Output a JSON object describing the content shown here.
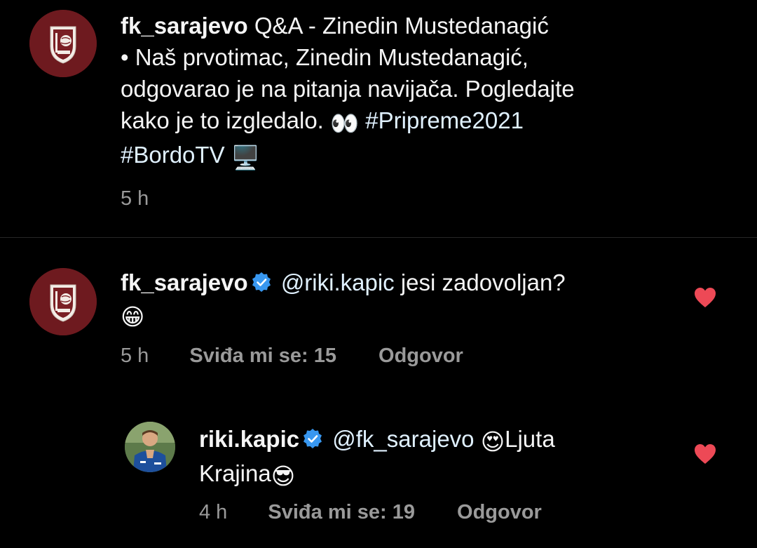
{
  "post": {
    "username": "fk_sarajevo",
    "caption_line1": "Q&A - Zinedin Mustedanagić",
    "caption_line2": "• Naš prvotimac, Zinedin Mustedanagić,",
    "caption_line3": "odgovarao je na pitanja navijača. Pogledajte",
    "caption_line4": "kako je to izgledalo.",
    "eyes_emoji": "👀",
    "hashtag1": "#Pripreme2021",
    "hashtag2": "#BordoTV",
    "tv_emoji": "🖥️",
    "time": "5 h"
  },
  "comments": [
    {
      "username": "fk_sarajevo",
      "mention": "@riki.kapic",
      "text": "jesi zadovoljan?",
      "emoji": "😁",
      "time": "5 h",
      "likes_label": "Sviđa mi se: 15",
      "reply_label": "Odgovor"
    }
  ],
  "replies": [
    {
      "username": "riki.kapic",
      "mention": "@fk_sarajevo",
      "emoji1": "😍",
      "text_part1": "Ljuta",
      "text_part2": "Krajina",
      "emoji2": "😎",
      "time": "4 h",
      "likes_label": "Sviđa mi se: 19",
      "reply_label": "Odgovor"
    }
  ],
  "colors": {
    "background": "#000000",
    "text": "#f5f5f5",
    "meta": "#9a9a9a",
    "heart": "#ed4956",
    "verified": "#3897f0",
    "club_maroon": "#6e1a1f"
  },
  "icons": {
    "verified": "verified-badge-icon",
    "heart": "heart-icon",
    "club_logo": "fk-sarajevo-crest-icon"
  }
}
